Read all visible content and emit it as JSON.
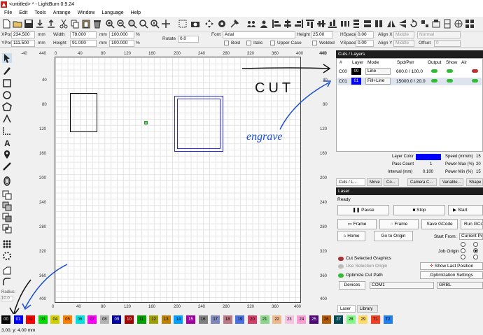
{
  "window": {
    "title": "<untitled> * - LightBurn 0.9.24"
  },
  "menu": [
    "File",
    "Edit",
    "Tools",
    "Arrange",
    "Window",
    "Language",
    "Help"
  ],
  "props": {
    "xpos_label": "XPos",
    "xpos": "234.500",
    "ypos_label": "YPos",
    "ypos": "111.500",
    "mm": "mm",
    "width_label": "Width",
    "width": "79.000",
    "height_label": "Height",
    "height": "91.000",
    "pct1": "100.000",
    "pct2": "100.000",
    "pct_sign": "%",
    "rotate_label": "Rotate",
    "rotate": "0.0",
    "font_label": "Font",
    "font": "Arial",
    "text_height_label": "Height",
    "text_height": "25.00",
    "hspace_label": "HSpace",
    "hspace": "0.00",
    "vspace_label": "VSpace",
    "vspace": "0.00",
    "alignx_label": "Align X",
    "alignx": "Middle",
    "aligny_label": "Align Y",
    "aligny": "Middle",
    "normal": "Normal",
    "offset_label": "Offset",
    "offset": "0",
    "bold": "Bold",
    "italic": "Italic",
    "upper": "Upper Case",
    "welded": "Welded"
  },
  "ruler_top": [
    "-40",
    "0",
    "40",
    "80",
    "120",
    "160",
    "200",
    "240",
    "280",
    "320",
    "360",
    "400",
    "440"
  ],
  "ruler_bottom": [
    "0",
    "40",
    "80",
    "120",
    "160",
    "200",
    "240",
    "280",
    "320",
    "360",
    "400"
  ],
  "ruler_right": [
    "440",
    "40",
    "80",
    "120",
    "160",
    "200",
    "240",
    "280",
    "320",
    "360",
    "400"
  ],
  "radius": {
    "label": "Radius:",
    "value": "10.0"
  },
  "cuts": {
    "title": "Cuts / Layers",
    "columns": [
      "#",
      "Layer",
      "Mode",
      "Spd/Pwr",
      "Output",
      "Show",
      "Air"
    ],
    "rows": [
      {
        "id": "C00",
        "layer": "00",
        "mode": "Line",
        "spdpwr": "600.0 / 100.0",
        "color": "#000000"
      },
      {
        "id": "C01",
        "layer": "01",
        "mode": "Fill+Line",
        "spdpwr": "15000.0 / 20.0",
        "color": "#0000ff"
      }
    ]
  },
  "layer_settings": {
    "layer_color_label": "Layer Color",
    "layer_color": "#0000ff",
    "speed_label": "Speed (mm/m)",
    "speed": "15",
    "pass_label": "Pass Count",
    "pass": "1",
    "pmax_label": "Power Max (%)",
    "pmax": "20",
    "interval_label": "Interval (mm)",
    "interval": "0.100",
    "pmin_label": "Power Min (%)",
    "pmin": "15"
  },
  "panel_tabs": [
    "Cuts / L...",
    "Move",
    "Co...",
    "Camera C...",
    "Variable...",
    "Shape"
  ],
  "laser": {
    "title": "Laser",
    "status": "Ready",
    "pause": "Pause",
    "stop": "Stop",
    "start": "Start",
    "frame1": "Frame",
    "frame2": "Frame",
    "save_gcode": "Save GCode",
    "run_gcode": "Run GCode",
    "home": "Home",
    "go_origin": "Go to Origin",
    "start_from_label": "Start From:",
    "start_from": "Current Position",
    "job_origin_label": "Job Origin",
    "cut_selected": "Cut Selected Graphics",
    "use_selection": "Use Selection Origin",
    "show_last": "Show Last Position",
    "optimize": "Optimize Cut Path",
    "opt_settings": "Optimization Settings",
    "devices": "Devices",
    "port": "COM1",
    "controller": "GRBL"
  },
  "bottom_tabs": [
    "Laser",
    "Library"
  ],
  "palette": [
    {
      "label": "00",
      "color": "#000000",
      "text": "#ffffff"
    },
    {
      "label": "01",
      "color": "#0000ff",
      "text": "#ffffff"
    },
    {
      "label": "02",
      "color": "#ff0000",
      "text": "#000000"
    },
    {
      "label": "03",
      "color": "#00e000",
      "text": "#000000"
    },
    {
      "label": "04",
      "color": "#d0d000",
      "text": "#000000"
    },
    {
      "label": "05",
      "color": "#ff8000",
      "text": "#000000"
    },
    {
      "label": "06",
      "color": "#00e0e0",
      "text": "#000000"
    },
    {
      "label": "07",
      "color": "#ff00ff",
      "text": "#000000"
    },
    {
      "label": "08",
      "color": "#b4b4b4",
      "text": "#000000"
    },
    {
      "label": "09",
      "color": "#0000a0",
      "text": "#ffffff"
    },
    {
      "label": "10",
      "color": "#a00000",
      "text": "#ffffff"
    },
    {
      "label": "11",
      "color": "#00a000",
      "text": "#000000"
    },
    {
      "label": "12",
      "color": "#a0a000",
      "text": "#000000"
    },
    {
      "label": "13",
      "color": "#c08000",
      "text": "#000000"
    },
    {
      "label": "14",
      "color": "#00a0ff",
      "text": "#000000"
    },
    {
      "label": "15",
      "color": "#a000a0",
      "text": "#ffffff"
    },
    {
      "label": "16",
      "color": "#808080",
      "text": "#000000"
    },
    {
      "label": "17",
      "color": "#7d87b9",
      "text": "#000000"
    },
    {
      "label": "18",
      "color": "#bb7784",
      "text": "#000000"
    },
    {
      "label": "19",
      "color": "#4a6fe3",
      "text": "#000000"
    },
    {
      "label": "20",
      "color": "#d33f6a",
      "text": "#000000"
    },
    {
      "label": "21",
      "color": "#8cd78c",
      "text": "#000000"
    },
    {
      "label": "22",
      "color": "#f0b98d",
      "text": "#000000"
    },
    {
      "label": "23",
      "color": "#f6c4e1",
      "text": "#000000"
    },
    {
      "label": "24",
      "color": "#fa9ed4",
      "text": "#000000"
    },
    {
      "label": "25",
      "color": "#500a78",
      "text": "#ffffff"
    },
    {
      "label": "26",
      "color": "#b45a00",
      "text": "#000000"
    },
    {
      "label": "27",
      "color": "#004754",
      "text": "#ffffff"
    },
    {
      "label": "28",
      "color": "#86fa88",
      "text": "#000000"
    },
    {
      "label": "29",
      "color": "#ffdb66",
      "text": "#000000"
    },
    {
      "label": "T1",
      "color": "#f04020",
      "text": "#000000"
    },
    {
      "label": "T2",
      "color": "#2080f0",
      "text": "#000000"
    }
  ],
  "status": "3.00, y: 4.00 mm",
  "annotations": {
    "cut": "CUT",
    "engrave": "engrave"
  },
  "colors": {
    "panel_header": "#1e1e1e",
    "selection": "#2a2ae0",
    "annotation": "#1a4fd0"
  }
}
